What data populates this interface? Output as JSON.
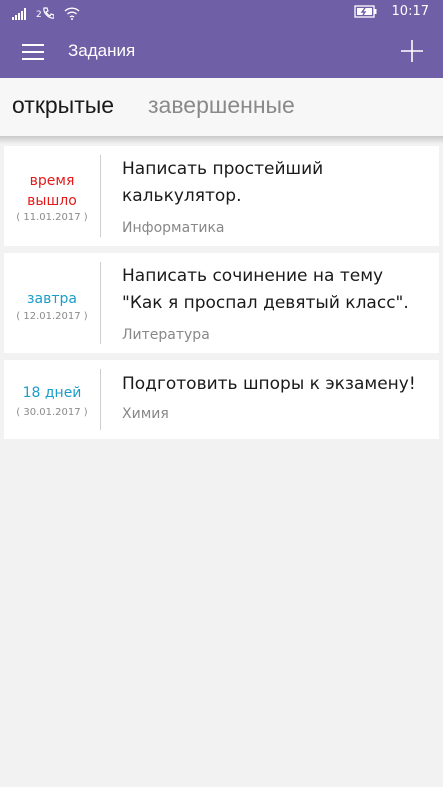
{
  "status": {
    "time": "10:17",
    "sim": "2"
  },
  "app": {
    "title": "Задания"
  },
  "tabs": [
    "открытые",
    "завершенные"
  ],
  "colors": {
    "header": "#6f5fa6",
    "overdue": "#e21a1a",
    "upcoming": "#1b9dc9"
  },
  "tasks": [
    {
      "due": "время вышло",
      "date": "( 11.01.2017 )",
      "title": "Написать простейший калькулятор.",
      "subject": "Информатика"
    },
    {
      "due": "завтра",
      "date": "( 12.01.2017 )",
      "title": "Написать сочинение на тему \"Как я проспал девятый класс\".",
      "subject": "Литература"
    },
    {
      "due": "18 дней",
      "date": "( 30.01.2017 )",
      "title": "Подготовить шпоры к экзамену!",
      "subject": "Химия"
    }
  ]
}
